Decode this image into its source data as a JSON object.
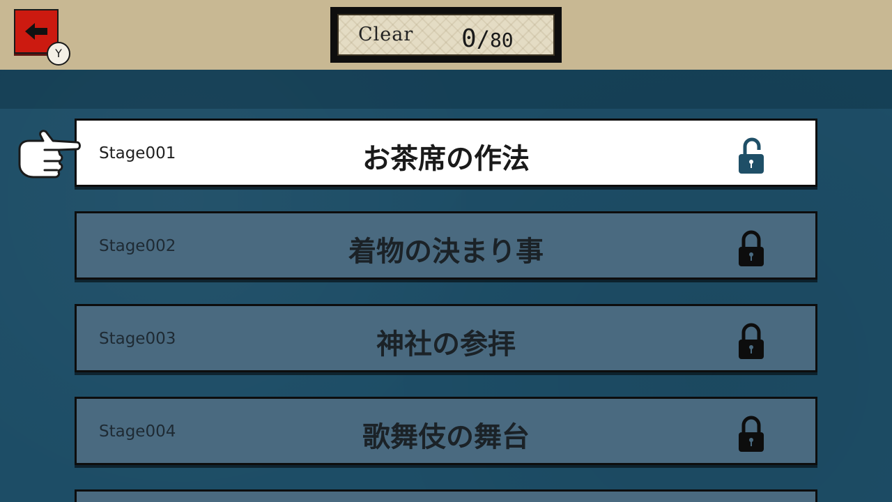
{
  "header": {
    "back_button_key": "Y",
    "clear_label": "Clear",
    "clear_count": "0",
    "clear_total": "80"
  },
  "stages": [
    {
      "id": "Stage001",
      "title": "お茶席の作法",
      "locked": false,
      "selected": true
    },
    {
      "id": "Stage002",
      "title": "着物の決まり事",
      "locked": true,
      "selected": false
    },
    {
      "id": "Stage003",
      "title": "神社の参拝",
      "locked": true,
      "selected": false
    },
    {
      "id": "Stage004",
      "title": "歌舞伎の舞台",
      "locked": true,
      "selected": false
    }
  ],
  "colors": {
    "back_button": "#cc1a10",
    "topbar": "#c8b893",
    "background": "#1d4d66",
    "selected_row": "#ffffff",
    "locked_row": "#4a6a80",
    "unlocked_icon": "#1f4f67"
  },
  "icons": {
    "back": "arrow-left-icon",
    "pointer": "pointing-hand-icon",
    "unlocked": "unlocked-padlock-icon",
    "locked": "locked-padlock-icon"
  }
}
